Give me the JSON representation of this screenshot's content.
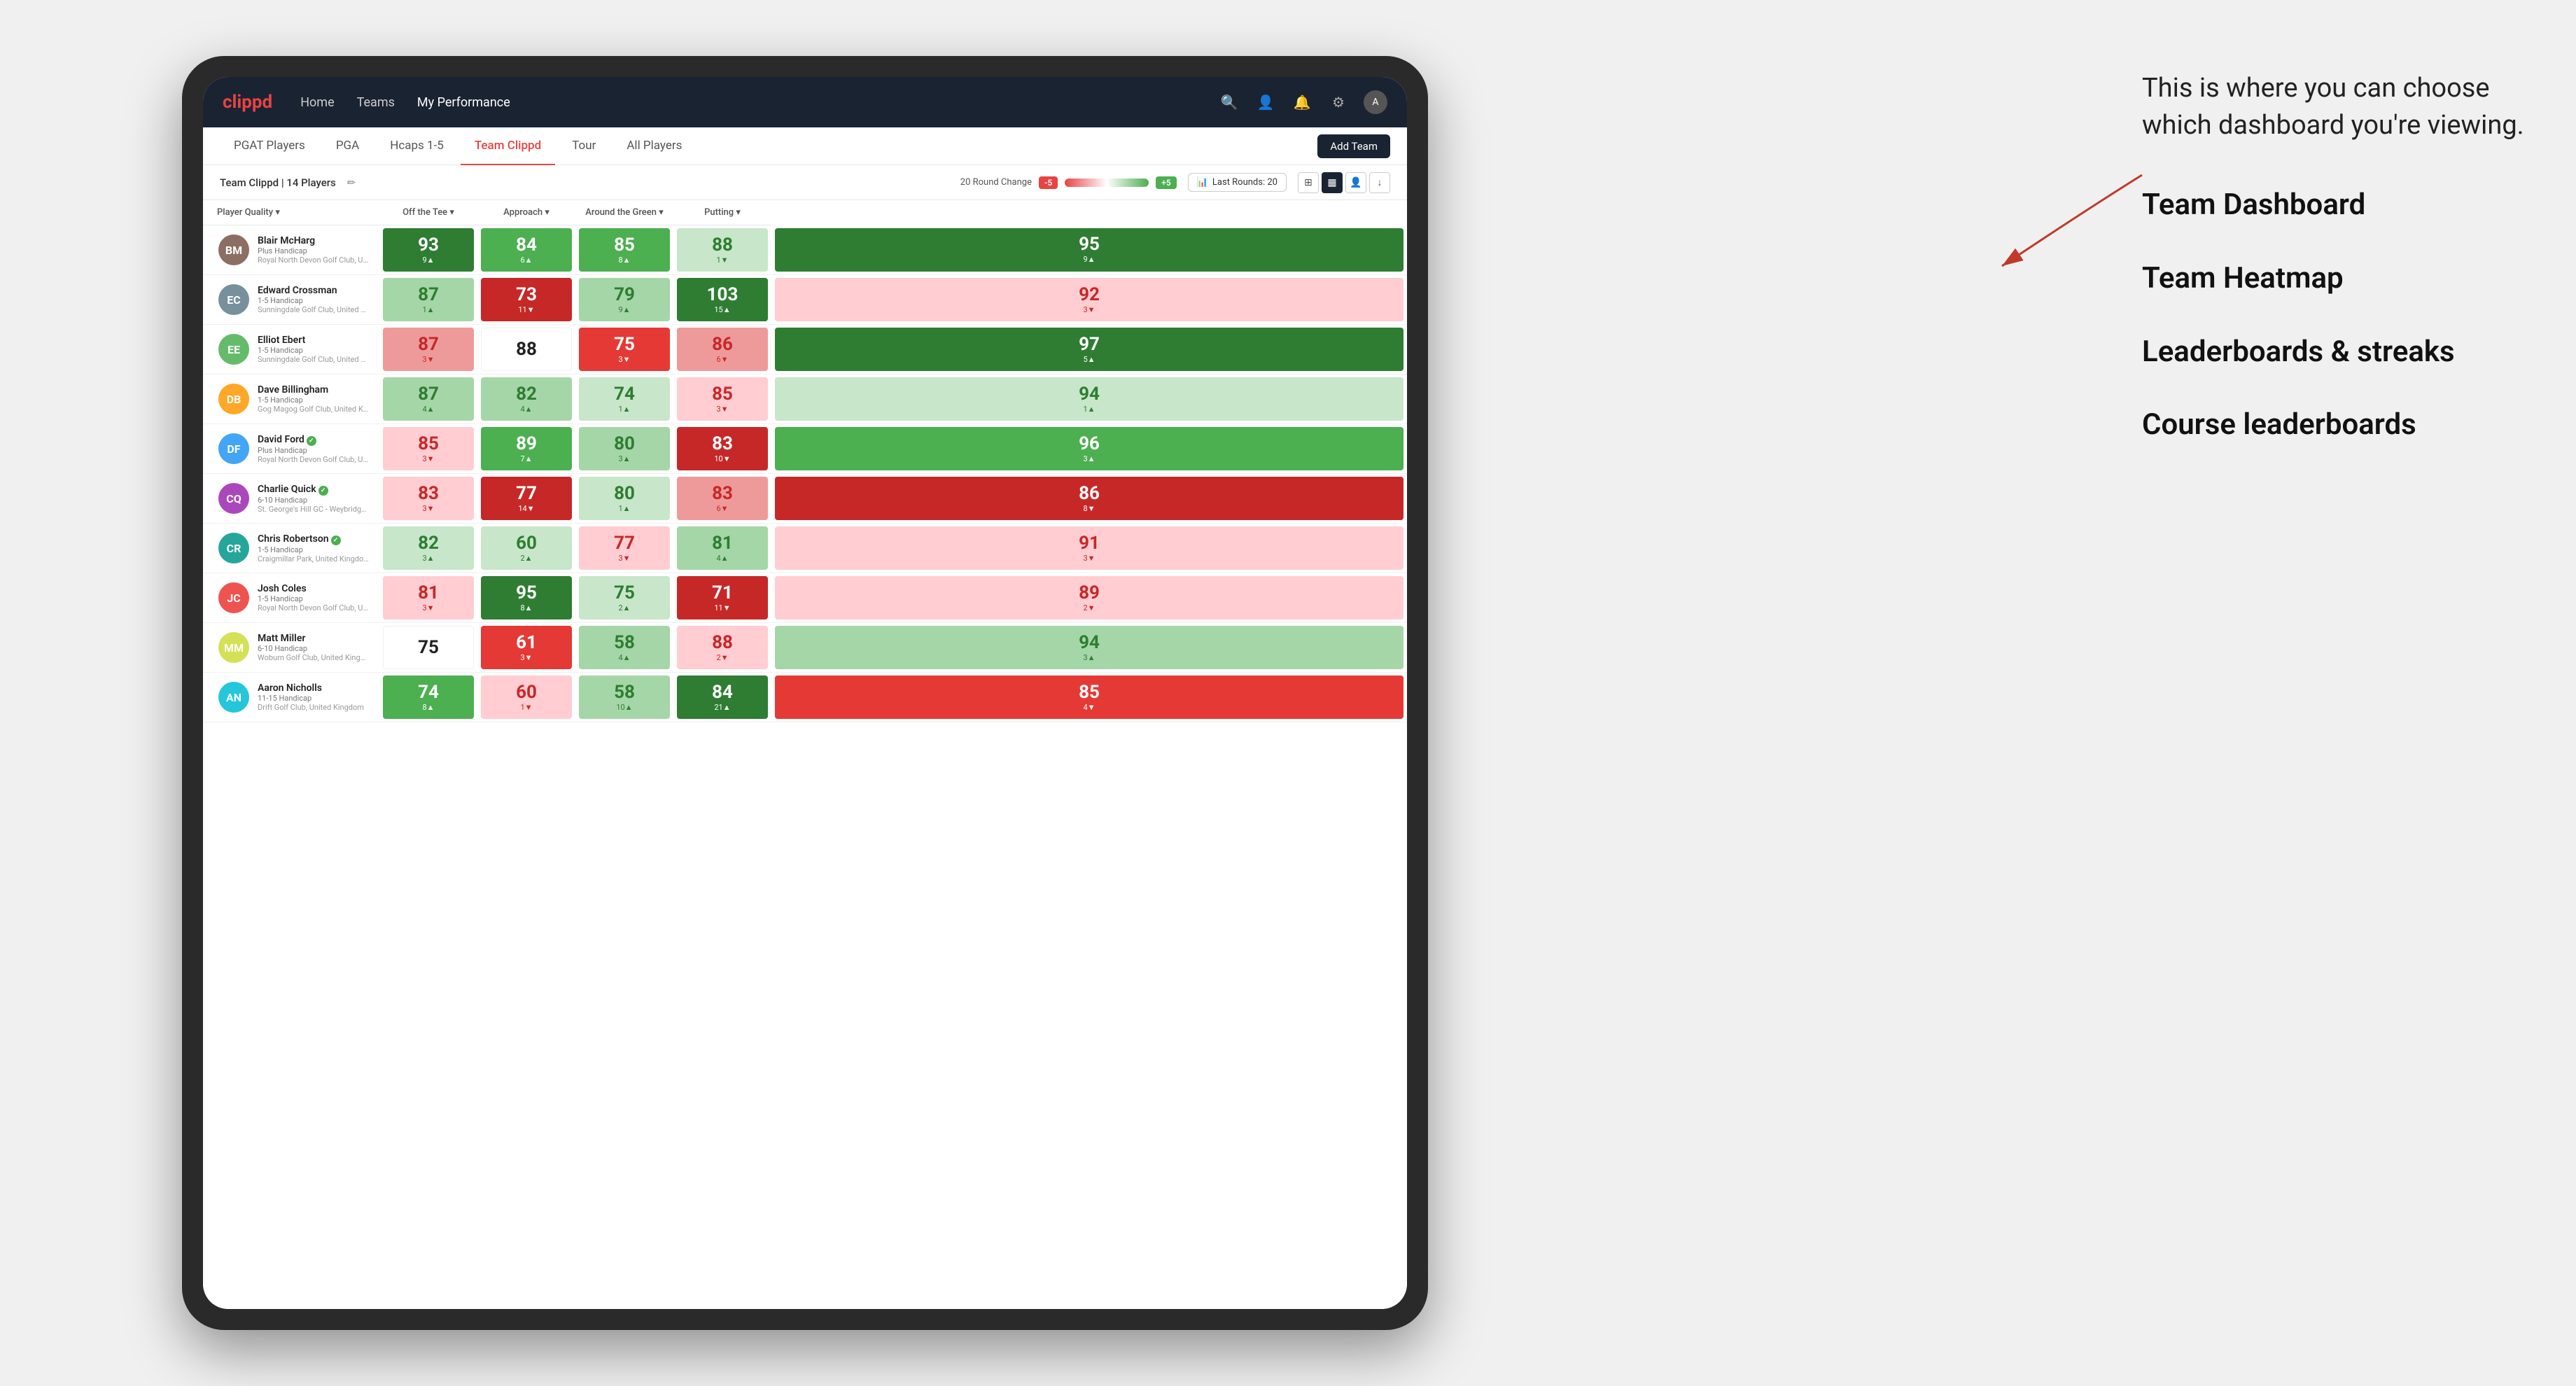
{
  "annotation": {
    "intro": "This is where you can choose which dashboard you're viewing.",
    "options": [
      "Team Dashboard",
      "Team Heatmap",
      "Leaderboards & streaks",
      "Course leaderboards"
    ]
  },
  "navbar": {
    "logo": "clippd",
    "links": [
      "Home",
      "Teams",
      "My Performance"
    ],
    "active_link": "My Performance"
  },
  "tabs": {
    "items": [
      "PGAT Players",
      "PGA",
      "Hcaps 1-5",
      "Team Clippd",
      "Tour",
      "All Players"
    ],
    "active": "Team Clippd",
    "add_button": "Add Team"
  },
  "subheader": {
    "team_label": "Team Clippd",
    "player_count": "14 Players",
    "round_change_label": "20 Round Change",
    "neg_value": "-5",
    "pos_value": "+5",
    "last_rounds_label": "Last Rounds:",
    "last_rounds_value": "20"
  },
  "table": {
    "columns": [
      {
        "id": "player",
        "label": "Player Quality"
      },
      {
        "id": "tee",
        "label": "Off the Tee"
      },
      {
        "id": "approach",
        "label": "Approach"
      },
      {
        "id": "green",
        "label": "Around the Green"
      },
      {
        "id": "putting",
        "label": "Putting"
      }
    ],
    "rows": [
      {
        "name": "Blair McHarg",
        "handicap": "Plus Handicap",
        "club": "Royal North Devon Golf Club, United Kingdom",
        "scores": {
          "quality": {
            "val": "93",
            "change": "9",
            "dir": "up",
            "color": "green-dark"
          },
          "tee": {
            "val": "84",
            "change": "6",
            "dir": "up",
            "color": "green-med"
          },
          "approach": {
            "val": "85",
            "change": "8",
            "dir": "up",
            "color": "green-med"
          },
          "green": {
            "val": "88",
            "change": "1",
            "dir": "down",
            "color": "green-pale"
          },
          "putting": {
            "val": "95",
            "change": "9",
            "dir": "up",
            "color": "green-dark"
          }
        }
      },
      {
        "name": "Edward Crossman",
        "handicap": "1-5 Handicap",
        "club": "Sunningdale Golf Club, United Kingdom",
        "scores": {
          "quality": {
            "val": "87",
            "change": "1",
            "dir": "up",
            "color": "green-light"
          },
          "tee": {
            "val": "73",
            "change": "11",
            "dir": "down",
            "color": "red-dark"
          },
          "approach": {
            "val": "79",
            "change": "9",
            "dir": "up",
            "color": "green-light"
          },
          "green": {
            "val": "103",
            "change": "15",
            "dir": "up",
            "color": "green-dark"
          },
          "putting": {
            "val": "92",
            "change": "3",
            "dir": "down",
            "color": "red-pale"
          }
        }
      },
      {
        "name": "Elliot Ebert",
        "handicap": "1-5 Handicap",
        "club": "Sunningdale Golf Club, United Kingdom",
        "scores": {
          "quality": {
            "val": "87",
            "change": "3",
            "dir": "down",
            "color": "red-light"
          },
          "tee": {
            "val": "88",
            "change": "",
            "dir": "",
            "color": "white"
          },
          "approach": {
            "val": "75",
            "change": "3",
            "dir": "down",
            "color": "red-med"
          },
          "green": {
            "val": "86",
            "change": "6",
            "dir": "down",
            "color": "red-light"
          },
          "putting": {
            "val": "97",
            "change": "5",
            "dir": "up",
            "color": "green-dark"
          }
        }
      },
      {
        "name": "Dave Billingham",
        "handicap": "1-5 Handicap",
        "club": "Gog Magog Golf Club, United Kingdom",
        "scores": {
          "quality": {
            "val": "87",
            "change": "4",
            "dir": "up",
            "color": "green-light"
          },
          "tee": {
            "val": "82",
            "change": "4",
            "dir": "up",
            "color": "green-light"
          },
          "approach": {
            "val": "74",
            "change": "1",
            "dir": "up",
            "color": "green-pale"
          },
          "green": {
            "val": "85",
            "change": "3",
            "dir": "down",
            "color": "red-pale"
          },
          "putting": {
            "val": "94",
            "change": "1",
            "dir": "up",
            "color": "green-pale"
          }
        }
      },
      {
        "name": "David Ford",
        "handicap": "Plus Handicap",
        "club": "Royal North Devon Golf Club, United Kingdom",
        "verified": true,
        "scores": {
          "quality": {
            "val": "85",
            "change": "3",
            "dir": "down",
            "color": "red-pale"
          },
          "tee": {
            "val": "89",
            "change": "7",
            "dir": "up",
            "color": "green-med"
          },
          "approach": {
            "val": "80",
            "change": "3",
            "dir": "up",
            "color": "green-light"
          },
          "green": {
            "val": "83",
            "change": "10",
            "dir": "down",
            "color": "red-dark"
          },
          "putting": {
            "val": "96",
            "change": "3",
            "dir": "up",
            "color": "green-med"
          }
        }
      },
      {
        "name": "Charlie Quick",
        "handicap": "6-10 Handicap",
        "club": "St. George's Hill GC - Weybridge - Surrey, Uni...",
        "verified": true,
        "scores": {
          "quality": {
            "val": "83",
            "change": "3",
            "dir": "down",
            "color": "red-pale"
          },
          "tee": {
            "val": "77",
            "change": "14",
            "dir": "down",
            "color": "red-dark"
          },
          "approach": {
            "val": "80",
            "change": "1",
            "dir": "up",
            "color": "green-pale"
          },
          "green": {
            "val": "83",
            "change": "6",
            "dir": "down",
            "color": "red-light"
          },
          "putting": {
            "val": "86",
            "change": "8",
            "dir": "down",
            "color": "red-dark"
          }
        }
      },
      {
        "name": "Chris Robertson",
        "handicap": "1-5 Handicap",
        "club": "Craigmillar Park, United Kingdom",
        "verified": true,
        "scores": {
          "quality": {
            "val": "82",
            "change": "3",
            "dir": "up",
            "color": "green-pale"
          },
          "tee": {
            "val": "60",
            "change": "2",
            "dir": "up",
            "color": "green-pale"
          },
          "approach": {
            "val": "77",
            "change": "3",
            "dir": "down",
            "color": "red-pale"
          },
          "green": {
            "val": "81",
            "change": "4",
            "dir": "up",
            "color": "green-light"
          },
          "putting": {
            "val": "91",
            "change": "3",
            "dir": "down",
            "color": "red-pale"
          }
        }
      },
      {
        "name": "Josh Coles",
        "handicap": "1-5 Handicap",
        "club": "Royal North Devon Golf Club, United Kingdom",
        "scores": {
          "quality": {
            "val": "81",
            "change": "3",
            "dir": "down",
            "color": "red-pale"
          },
          "tee": {
            "val": "95",
            "change": "8",
            "dir": "up",
            "color": "green-dark"
          },
          "approach": {
            "val": "75",
            "change": "2",
            "dir": "up",
            "color": "green-pale"
          },
          "green": {
            "val": "71",
            "change": "11",
            "dir": "down",
            "color": "red-dark"
          },
          "putting": {
            "val": "89",
            "change": "2",
            "dir": "down",
            "color": "red-pale"
          }
        }
      },
      {
        "name": "Matt Miller",
        "handicap": "6-10 Handicap",
        "club": "Woburn Golf Club, United Kingdom",
        "scores": {
          "quality": {
            "val": "75",
            "change": "",
            "dir": "",
            "color": "white"
          },
          "tee": {
            "val": "61",
            "change": "3",
            "dir": "down",
            "color": "red-med"
          },
          "approach": {
            "val": "58",
            "change": "4",
            "dir": "up",
            "color": "green-light"
          },
          "green": {
            "val": "88",
            "change": "2",
            "dir": "down",
            "color": "red-pale"
          },
          "putting": {
            "val": "94",
            "change": "3",
            "dir": "up",
            "color": "green-light"
          }
        }
      },
      {
        "name": "Aaron Nicholls",
        "handicap": "11-15 Handicap",
        "club": "Drift Golf Club, United Kingdom",
        "scores": {
          "quality": {
            "val": "74",
            "change": "8",
            "dir": "up",
            "color": "green-med"
          },
          "tee": {
            "val": "60",
            "change": "1",
            "dir": "down",
            "color": "red-pale"
          },
          "approach": {
            "val": "58",
            "change": "10",
            "dir": "up",
            "color": "green-light"
          },
          "green": {
            "val": "84",
            "change": "21",
            "dir": "up",
            "color": "green-dark"
          },
          "putting": {
            "val": "85",
            "change": "4",
            "dir": "down",
            "color": "red-med"
          }
        }
      }
    ]
  }
}
